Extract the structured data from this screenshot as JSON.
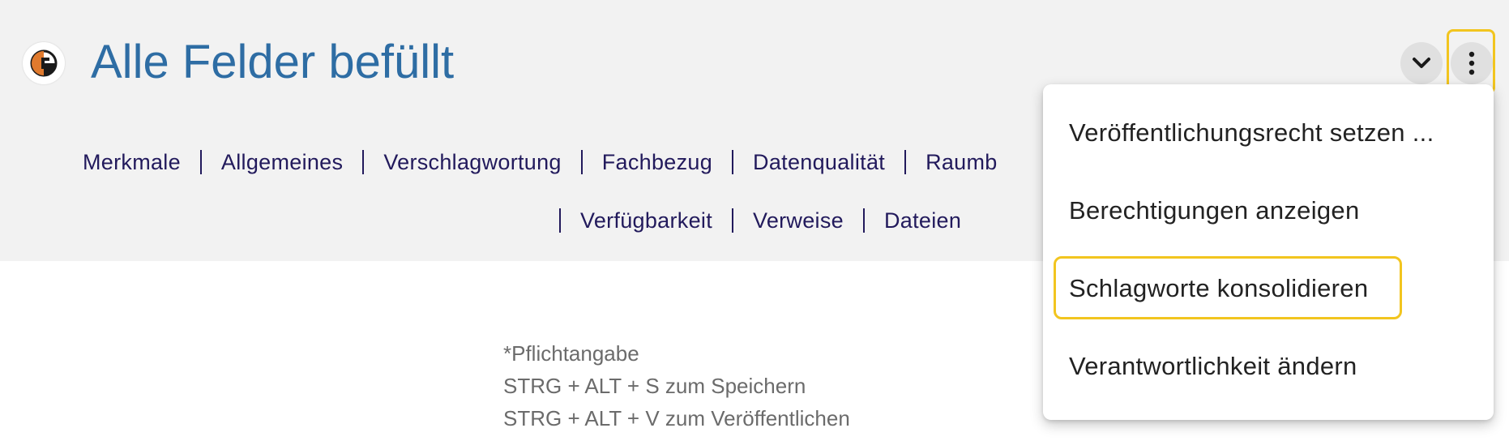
{
  "header": {
    "title": "Alle Felder befüllt",
    "logo": "orange-black-circle-logo",
    "expand_icon": "chevron-down-icon",
    "more_icon": "more-vert-icon"
  },
  "nav": {
    "row1": [
      "Merkmale",
      "Allgemeines",
      "Verschlagwortung",
      "Fachbezug",
      "Datenqualität",
      "Raumb"
    ],
    "row2": [
      "Verfügbarkeit",
      "Verweise",
      "Dateien"
    ]
  },
  "hints": {
    "required": "*Pflichtangabe",
    "save": "STRG + ALT + S zum Speichern",
    "publish": "STRG + ALT + V zum Veröffentlichen"
  },
  "menu": {
    "items": [
      "Veröffentlichungsrecht setzen ...",
      "Berechtigungen anzeigen",
      "Schlagworte konsolidieren",
      "Verantwortlichkeit ändern"
    ],
    "focused_index": 2
  },
  "colors": {
    "title": "#2e6da4",
    "nav": "#221a5c",
    "focus": "#f2c51f",
    "header_bg": "#f2f2f2",
    "logo_orange": "#e07a2e"
  }
}
